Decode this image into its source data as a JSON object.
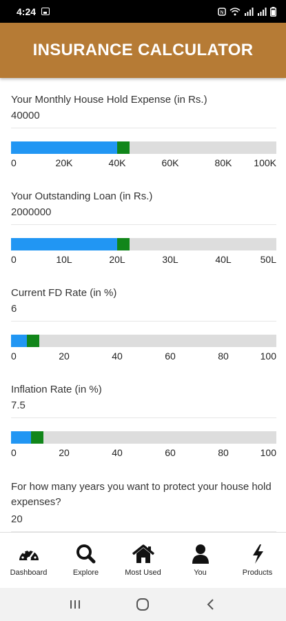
{
  "status": {
    "time": "4:24",
    "battery_percent": 0.85
  },
  "header": {
    "title": "INSURANCE CALCULATOR"
  },
  "fields": [
    {
      "label": "Your Monthly House Hold Expense (in Rs.)",
      "value": "40000",
      "slider_fraction": 0.4,
      "ticks": [
        "0",
        "20K",
        "40K",
        "60K",
        "80K",
        "100K"
      ]
    },
    {
      "label": "Your Outstanding Loan (in Rs.)",
      "value": "2000000",
      "slider_fraction": 0.4,
      "ticks": [
        "0",
        "10L",
        "20L",
        "30L",
        "40L",
        "50L"
      ]
    },
    {
      "label": "Current FD Rate (in %)",
      "value": "6",
      "slider_fraction": 0.06,
      "ticks": [
        "0",
        "20",
        "40",
        "60",
        "80",
        "100"
      ]
    },
    {
      "label": "Inflation Rate (in %)",
      "value": "7.5",
      "slider_fraction": 0.075,
      "ticks": [
        "0",
        "20",
        "40",
        "60",
        "80",
        "100"
      ]
    },
    {
      "label": "For how many years you want to protect your house hold expenses?",
      "value": "20"
    }
  ],
  "colors": {
    "header": "#b67b35",
    "slider_fill": "#2196f3",
    "slider_thumb": "#11861a",
    "slider_track": "#dddddd"
  },
  "nav": {
    "items": [
      {
        "label": "Dashboard",
        "icon": "dashboard-gauge-icon"
      },
      {
        "label": "Explore",
        "icon": "search-icon"
      },
      {
        "label": "Most Used",
        "icon": "home-icon"
      },
      {
        "label": "You",
        "icon": "person-icon"
      },
      {
        "label": "Products",
        "icon": "lightning-icon"
      }
    ]
  },
  "system_nav": {
    "icons": [
      "recents-icon",
      "home-circle-icon",
      "back-icon"
    ]
  }
}
